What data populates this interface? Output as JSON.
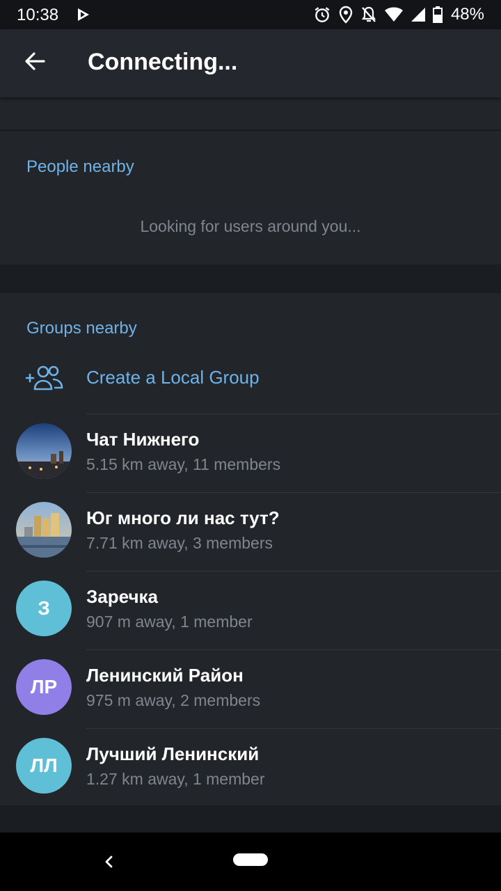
{
  "status_bar": {
    "time": "10:38",
    "battery": "48%",
    "icons": [
      "play-store-icon",
      "alarm-icon",
      "location-icon",
      "notifications-off-icon",
      "wifi-icon",
      "cell-signal-icon",
      "battery-icon"
    ]
  },
  "app_bar": {
    "title": "Connecting...",
    "back_icon": "arrow-back-icon"
  },
  "people_nearby": {
    "header": "People nearby",
    "status": "Looking for users around you..."
  },
  "groups_nearby": {
    "header": "Groups nearby",
    "create_label": "Create a Local Group",
    "create_icon": "add-group-icon",
    "groups": [
      {
        "name": "Чат Нижнего",
        "meta": "5.15 km away, 11 members",
        "avatar": "photo",
        "avatar_initials": ""
      },
      {
        "name": "Юг много ли нас тут?",
        "meta": "7.71 km away, 3 members",
        "avatar": "photo",
        "avatar_initials": ""
      },
      {
        "name": "Заречка",
        "meta": "907 m away, 1 member",
        "avatar": "initials",
        "avatar_initials": "З",
        "avatar_color": "#5ebfd6"
      },
      {
        "name": "Ленинский Район",
        "meta": "975 m away, 2 members",
        "avatar": "initials",
        "avatar_initials": "ЛР",
        "avatar_color": "#8f7fe6"
      },
      {
        "name": "Лучший Ленинский",
        "meta": "1.27 km away, 1 member",
        "avatar": "initials",
        "avatar_initials": "ЛЛ",
        "avatar_color": "#5ebfd6"
      }
    ]
  },
  "colors": {
    "accent": "#6fb2e8",
    "background": "#1a1d21",
    "surface": "#22252a",
    "app_bar": "#24282e"
  }
}
